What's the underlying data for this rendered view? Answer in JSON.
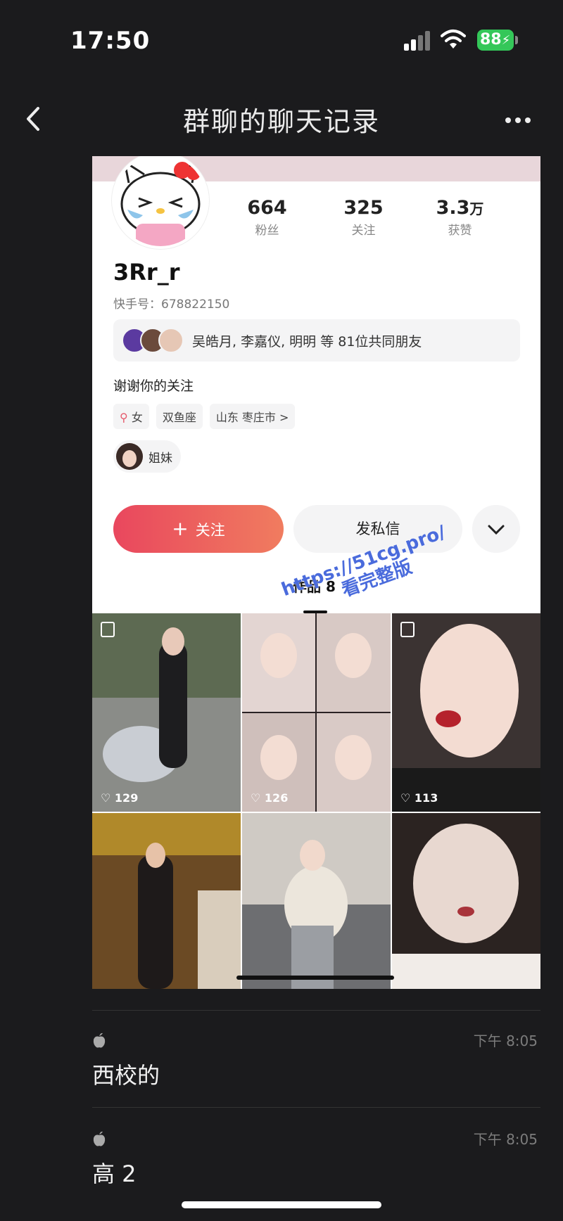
{
  "status_bar": {
    "time": "17:50",
    "battery": "88"
  },
  "nav": {
    "title": "群聊的聊天记录"
  },
  "profile": {
    "stats": [
      {
        "value": "664",
        "unit": "",
        "label": "粉丝"
      },
      {
        "value": "325",
        "unit": "",
        "label": "关注"
      },
      {
        "value": "3.3",
        "unit": "万",
        "label": "获赞"
      }
    ],
    "username": "3Rr_r",
    "kuaishou_id": "快手号：678822150",
    "mutual_friends": "吴皓月, 李嘉仪, 明明 等 81位共同朋友",
    "bio": "谢谢你的关注",
    "tags": {
      "gender": "女",
      "zodiac": "双鱼座",
      "location": "山东 枣庄市 >"
    },
    "relation": "姐妹",
    "follow_label": "关注",
    "dm_label": "发私信",
    "works_label": "作品 8",
    "watermark_line1": "https://51cg.pro/",
    "watermark_line2": "看完整版",
    "posts": [
      {
        "likes": "129"
      },
      {
        "likes": "126"
      },
      {
        "likes": "113"
      },
      {
        "likes": ""
      },
      {
        "likes": ""
      },
      {
        "likes": ""
      }
    ]
  },
  "messages": [
    {
      "time": "下午 8:05",
      "text": "西校的"
    },
    {
      "time": "下午 8:05",
      "text": "高 2"
    }
  ]
}
